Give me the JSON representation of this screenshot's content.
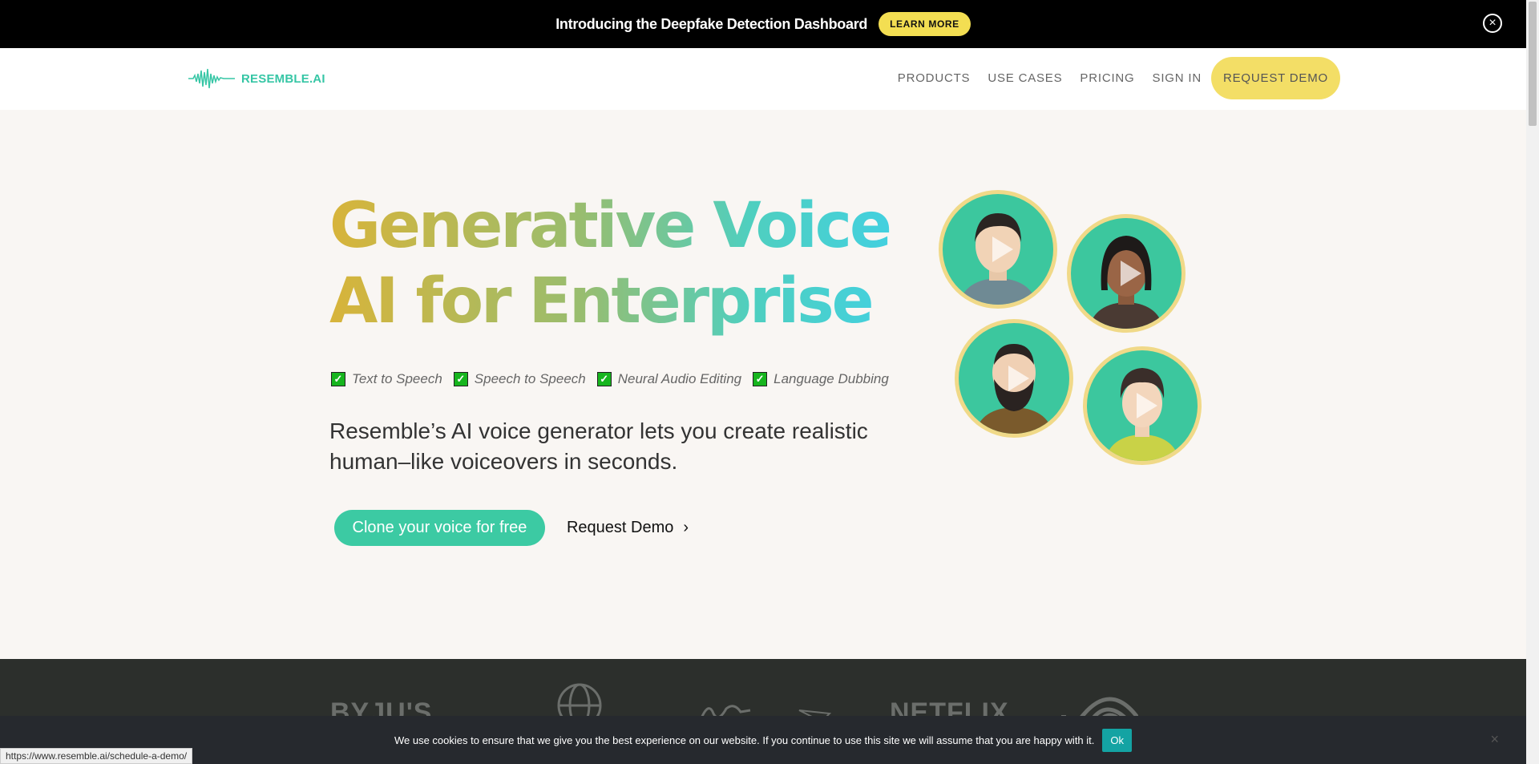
{
  "announcement": {
    "text": "Introducing the Deepfake Detection Dashboard",
    "button": "LEARN MORE",
    "close_icon": "close-circle-icon"
  },
  "nav": {
    "logo_text": "RESEMBLE.AI",
    "links": [
      "PRODUCTS",
      "USE CASES",
      "PRICING",
      "SIGN IN"
    ],
    "cta": "REQUEST DEMO"
  },
  "hero": {
    "title_line1": "Generative Voice",
    "title_line2": "AI for Enterprise",
    "features": [
      "Text to Speech",
      "Speech to Speech",
      "Neural Audio Editing",
      "Language Dubbing"
    ],
    "description": "Resemble’s AI voice generator lets you create realistic human–like voiceovers in seconds.",
    "primary_button": "Clone your voice for free",
    "secondary_button": "Request Demo"
  },
  "logos": [
    "BYJU'S",
    "NETFLIX"
  ],
  "cookie": {
    "text": "We use cookies to ensure that we give you the best experience on our website. If you continue to use this site we will assume that you are happy with it.",
    "ok": "Ok"
  },
  "status_url": "https://www.resemble.ai/schedule-a-demo/",
  "colors": {
    "brand": "#36c6a5",
    "yellow": "#f3de52",
    "dark": "#2c2f2c"
  }
}
